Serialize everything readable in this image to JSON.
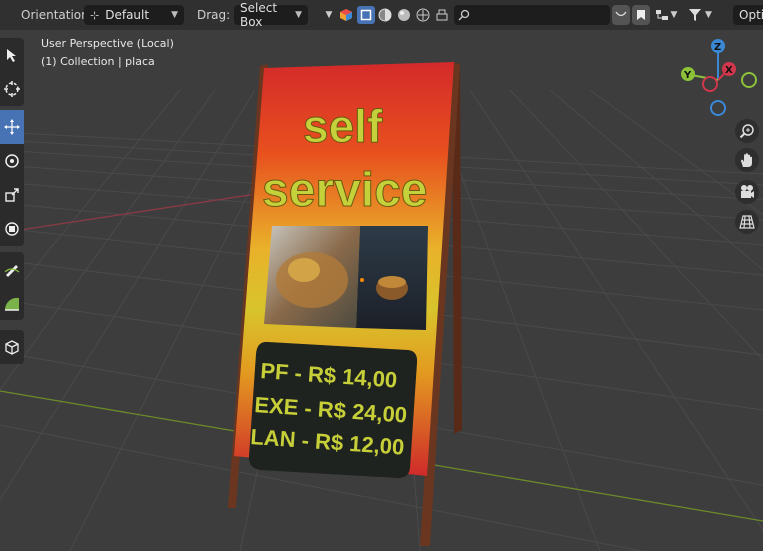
{
  "header": {
    "orientation_label": "Orientation:",
    "orientation_value": "Default",
    "drag_label": "Drag:",
    "drag_value": "Select Box",
    "search_value": "",
    "options_label": "Optio"
  },
  "viewport": {
    "perspective": "User Perspective (Local)",
    "collection": "(1) Collection | placa"
  },
  "gizmo": {
    "z": "Z",
    "y": "Y",
    "x": "X"
  },
  "sign": {
    "line1": "self",
    "line2": "service",
    "price1": "PF - R$ 14,00",
    "price2": "EXE - R$ 24,00",
    "price3": "LAN - R$ 12,00"
  },
  "tools": [
    "select-box-icon",
    "cursor-icon",
    "move-icon",
    "rotate-icon",
    "scale-icon",
    "transform-icon",
    "annotate-icon",
    "measure-icon",
    "add-cube-icon"
  ],
  "colors": {
    "accent": "#4772b3",
    "x_axis": "#d0364c",
    "y_axis": "#8bc23a",
    "z_axis": "#3b89d6"
  }
}
